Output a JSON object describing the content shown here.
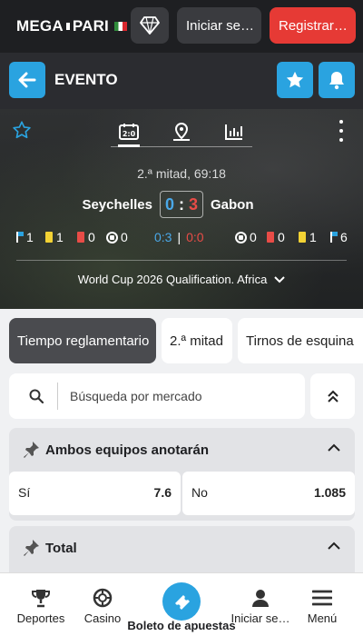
{
  "header": {
    "logo_text_left": "MEGA",
    "logo_text_right": "PARI",
    "login_label": "Iniciar se…",
    "register_label": "Registrar…",
    "brand_color": "#e63a35"
  },
  "event_bar": {
    "title": "EVENTO"
  },
  "scoreboard": {
    "tabs": [
      "scoreboard-tab",
      "field-tab",
      "stats-tab"
    ],
    "period": "2.ª mitad, 69:18",
    "home_team": "Seychelles",
    "away_team": "Gabon",
    "home_score": "0",
    "away_score": "3",
    "score_separator": ":",
    "home_stats": {
      "corners": "1",
      "yellow": "1",
      "red": "0",
      "goals": "0"
    },
    "halftime": {
      "first": "0:3",
      "second": "0:0"
    },
    "away_stats": {
      "goals": "0",
      "red": "0",
      "yellow": "1",
      "corners": "6"
    },
    "tournament": "World Cup 2026 Qualification. Africa"
  },
  "market_tabs": [
    {
      "label": "Tiempo reglamentario",
      "active": true
    },
    {
      "label": "2.ª mitad",
      "active": false
    },
    {
      "label": "Tirnos de esquina",
      "active": false
    }
  ],
  "search": {
    "placeholder": "Búsqueda por mercado"
  },
  "markets": [
    {
      "title": "Ambos equipos anotarán",
      "outcomes": [
        {
          "label": "Sí",
          "odds": "7.6"
        },
        {
          "label": "No",
          "odds": "1.085"
        }
      ]
    },
    {
      "title": "Total",
      "outcomes": []
    }
  ],
  "bottom_nav": {
    "sports": "Deportes",
    "casino": "Casino",
    "betslip": "Boleto de apuestas",
    "login": "Iniciar se…",
    "menu": "Menú"
  },
  "colors": {
    "accent": "#2aa3e0",
    "home_score": "#4aa8e8",
    "away_score": "#e84c47"
  }
}
